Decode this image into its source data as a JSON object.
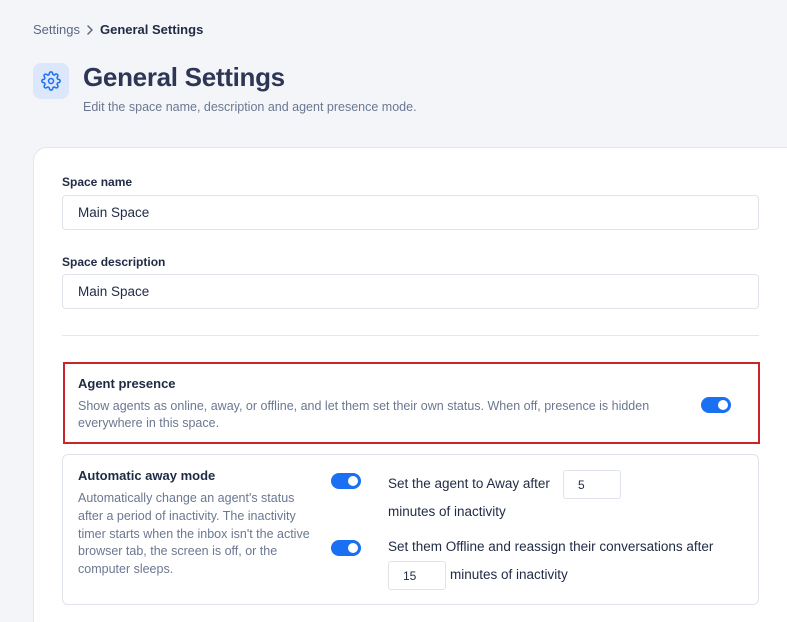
{
  "breadcrumb": {
    "parent": "Settings",
    "current": "General Settings"
  },
  "header": {
    "icon": "gear-icon",
    "title": "General Settings",
    "subtitle": "Edit the space name, description and agent presence mode."
  },
  "form": {
    "space_name": {
      "label": "Space name",
      "value": "Main Space"
    },
    "space_description": {
      "label": "Space description",
      "value": "Main Space"
    }
  },
  "agent_presence": {
    "title": "Agent presence",
    "description": "Show agents as online, away, or offline, and let them set their own status. When off, presence is hidden everywhere in this space.",
    "enabled": true
  },
  "automatic_away": {
    "title": "Automatic away mode",
    "description": "Automatically change an agent's status after a period of inactivity. The inactivity timer starts when the inbox isn't the active browser tab, the screen is off, or the computer sleeps.",
    "away_rule": {
      "enabled": true,
      "prefix": "Set the agent to Away after",
      "minutes": "5",
      "suffix": "minutes of inactivity"
    },
    "offline_rule": {
      "enabled": true,
      "prefix": "Set them Offline and reassign their conversations after",
      "minutes": "15",
      "suffix": "minutes of inactivity"
    }
  },
  "colors": {
    "accent": "#1a6ff2",
    "highlight_border": "#c8262b",
    "icon_bg": "#dde7fb"
  }
}
